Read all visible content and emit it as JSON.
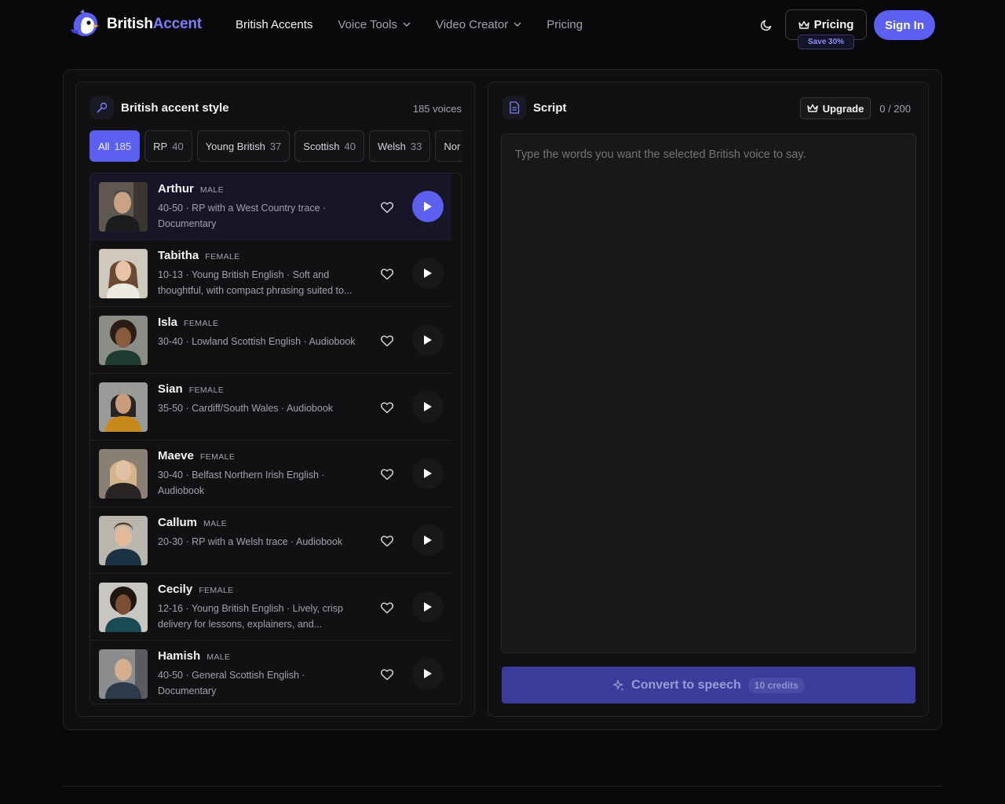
{
  "header": {
    "brand_part1": "British",
    "brand_part2": "Accent",
    "nav": [
      {
        "label": "British Accents",
        "dropdown": false,
        "active": true
      },
      {
        "label": "Voice Tools",
        "dropdown": true,
        "active": false
      },
      {
        "label": "Video Creator",
        "dropdown": true,
        "active": false
      },
      {
        "label": "Pricing",
        "dropdown": false,
        "active": false
      }
    ],
    "pricing_label": "Pricing",
    "save_badge": "Save 30%",
    "signin_label": "Sign In"
  },
  "voices_panel": {
    "title": "British accent style",
    "count_label": "185 voices",
    "filters": [
      {
        "label": "All",
        "count": "185",
        "active": true
      },
      {
        "label": "RP",
        "count": "40",
        "active": false
      },
      {
        "label": "Young British",
        "count": "37",
        "active": false
      },
      {
        "label": "Scottish",
        "count": "40",
        "active": false
      },
      {
        "label": "Welsh",
        "count": "33",
        "active": false
      },
      {
        "label": "Nor",
        "count": "",
        "active": false
      }
    ],
    "voices": [
      {
        "name": "Arthur",
        "gender": "MALE",
        "desc": "40-50 · RP with a West Country trace · Documentary",
        "active": true
      },
      {
        "name": "Tabitha",
        "gender": "FEMALE",
        "desc": "10-13 · Young British English · Soft and thoughtful, with compact phrasing suited to...",
        "active": false
      },
      {
        "name": "Isla",
        "gender": "FEMALE",
        "desc": "30-40 · Lowland Scottish English · Audiobook",
        "active": false
      },
      {
        "name": "Sian",
        "gender": "FEMALE",
        "desc": "35-50 · Cardiff/South Wales · Audiobook",
        "active": false
      },
      {
        "name": "Maeve",
        "gender": "FEMALE",
        "desc": "30-40 · Belfast Northern Irish English · Audiobook",
        "active": false
      },
      {
        "name": "Callum",
        "gender": "MALE",
        "desc": "20-30 · RP with a Welsh trace · Audiobook",
        "active": false
      },
      {
        "name": "Cecily",
        "gender": "FEMALE",
        "desc": "12-16 · Young British English · Lively, crisp delivery for lessons, explainers, and...",
        "active": false
      },
      {
        "name": "Hamish",
        "gender": "MALE",
        "desc": "40-50 · General Scottish English · Documentary",
        "active": false
      }
    ]
  },
  "script_panel": {
    "title": "Script",
    "upgrade_label": "Upgrade",
    "char_count": "0 / 200",
    "placeholder": "Type the words you want the selected British voice to say.",
    "convert_label": "Convert to speech",
    "credits_label": "10 credits"
  },
  "colors": {
    "accent": "#5d5ff0",
    "background": "#09090b",
    "panel": "#111114"
  }
}
